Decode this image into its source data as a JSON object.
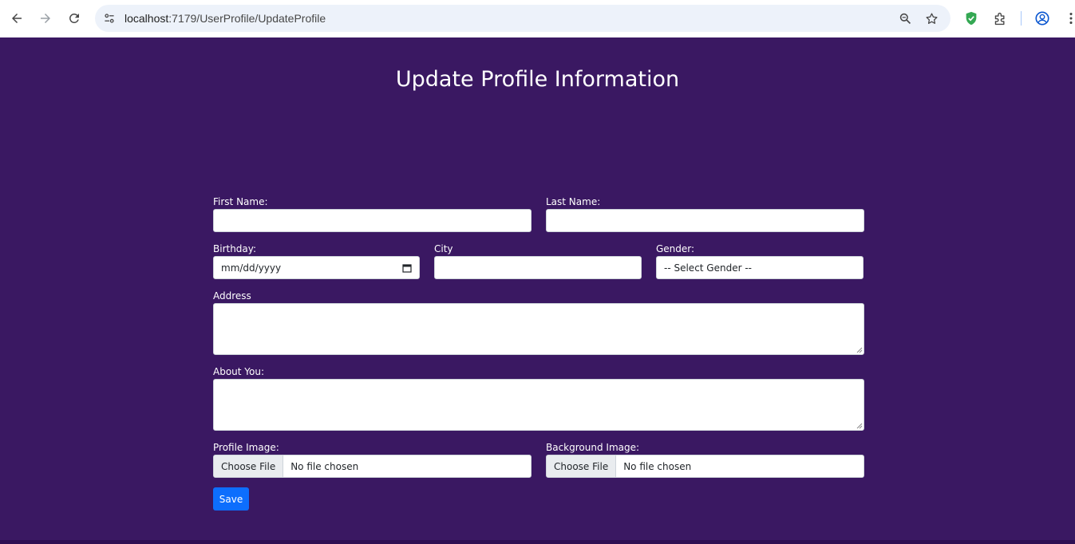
{
  "browser": {
    "url_host": "localhost",
    "url_path": ":7179/UserProfile/UpdateProfile"
  },
  "page": {
    "title": "Update Profile Information"
  },
  "form": {
    "first_name_label": "First Name:",
    "last_name_label": "Last Name:",
    "birthday_label": "Birthday:",
    "birthday_placeholder": "mm/dd/yyyy",
    "city_label": "City",
    "gender_label": "Gender:",
    "gender_selected": "-- Select Gender --",
    "address_label": "Address",
    "about_label": "About You:",
    "profile_image_label": "Profile Image:",
    "background_image_label": "Background Image:",
    "choose_file_label": "Choose File",
    "no_file_text": "No file chosen",
    "save_label": "Save"
  },
  "colors": {
    "page_background": "#3a1862",
    "save_button": "#0d6efd"
  }
}
